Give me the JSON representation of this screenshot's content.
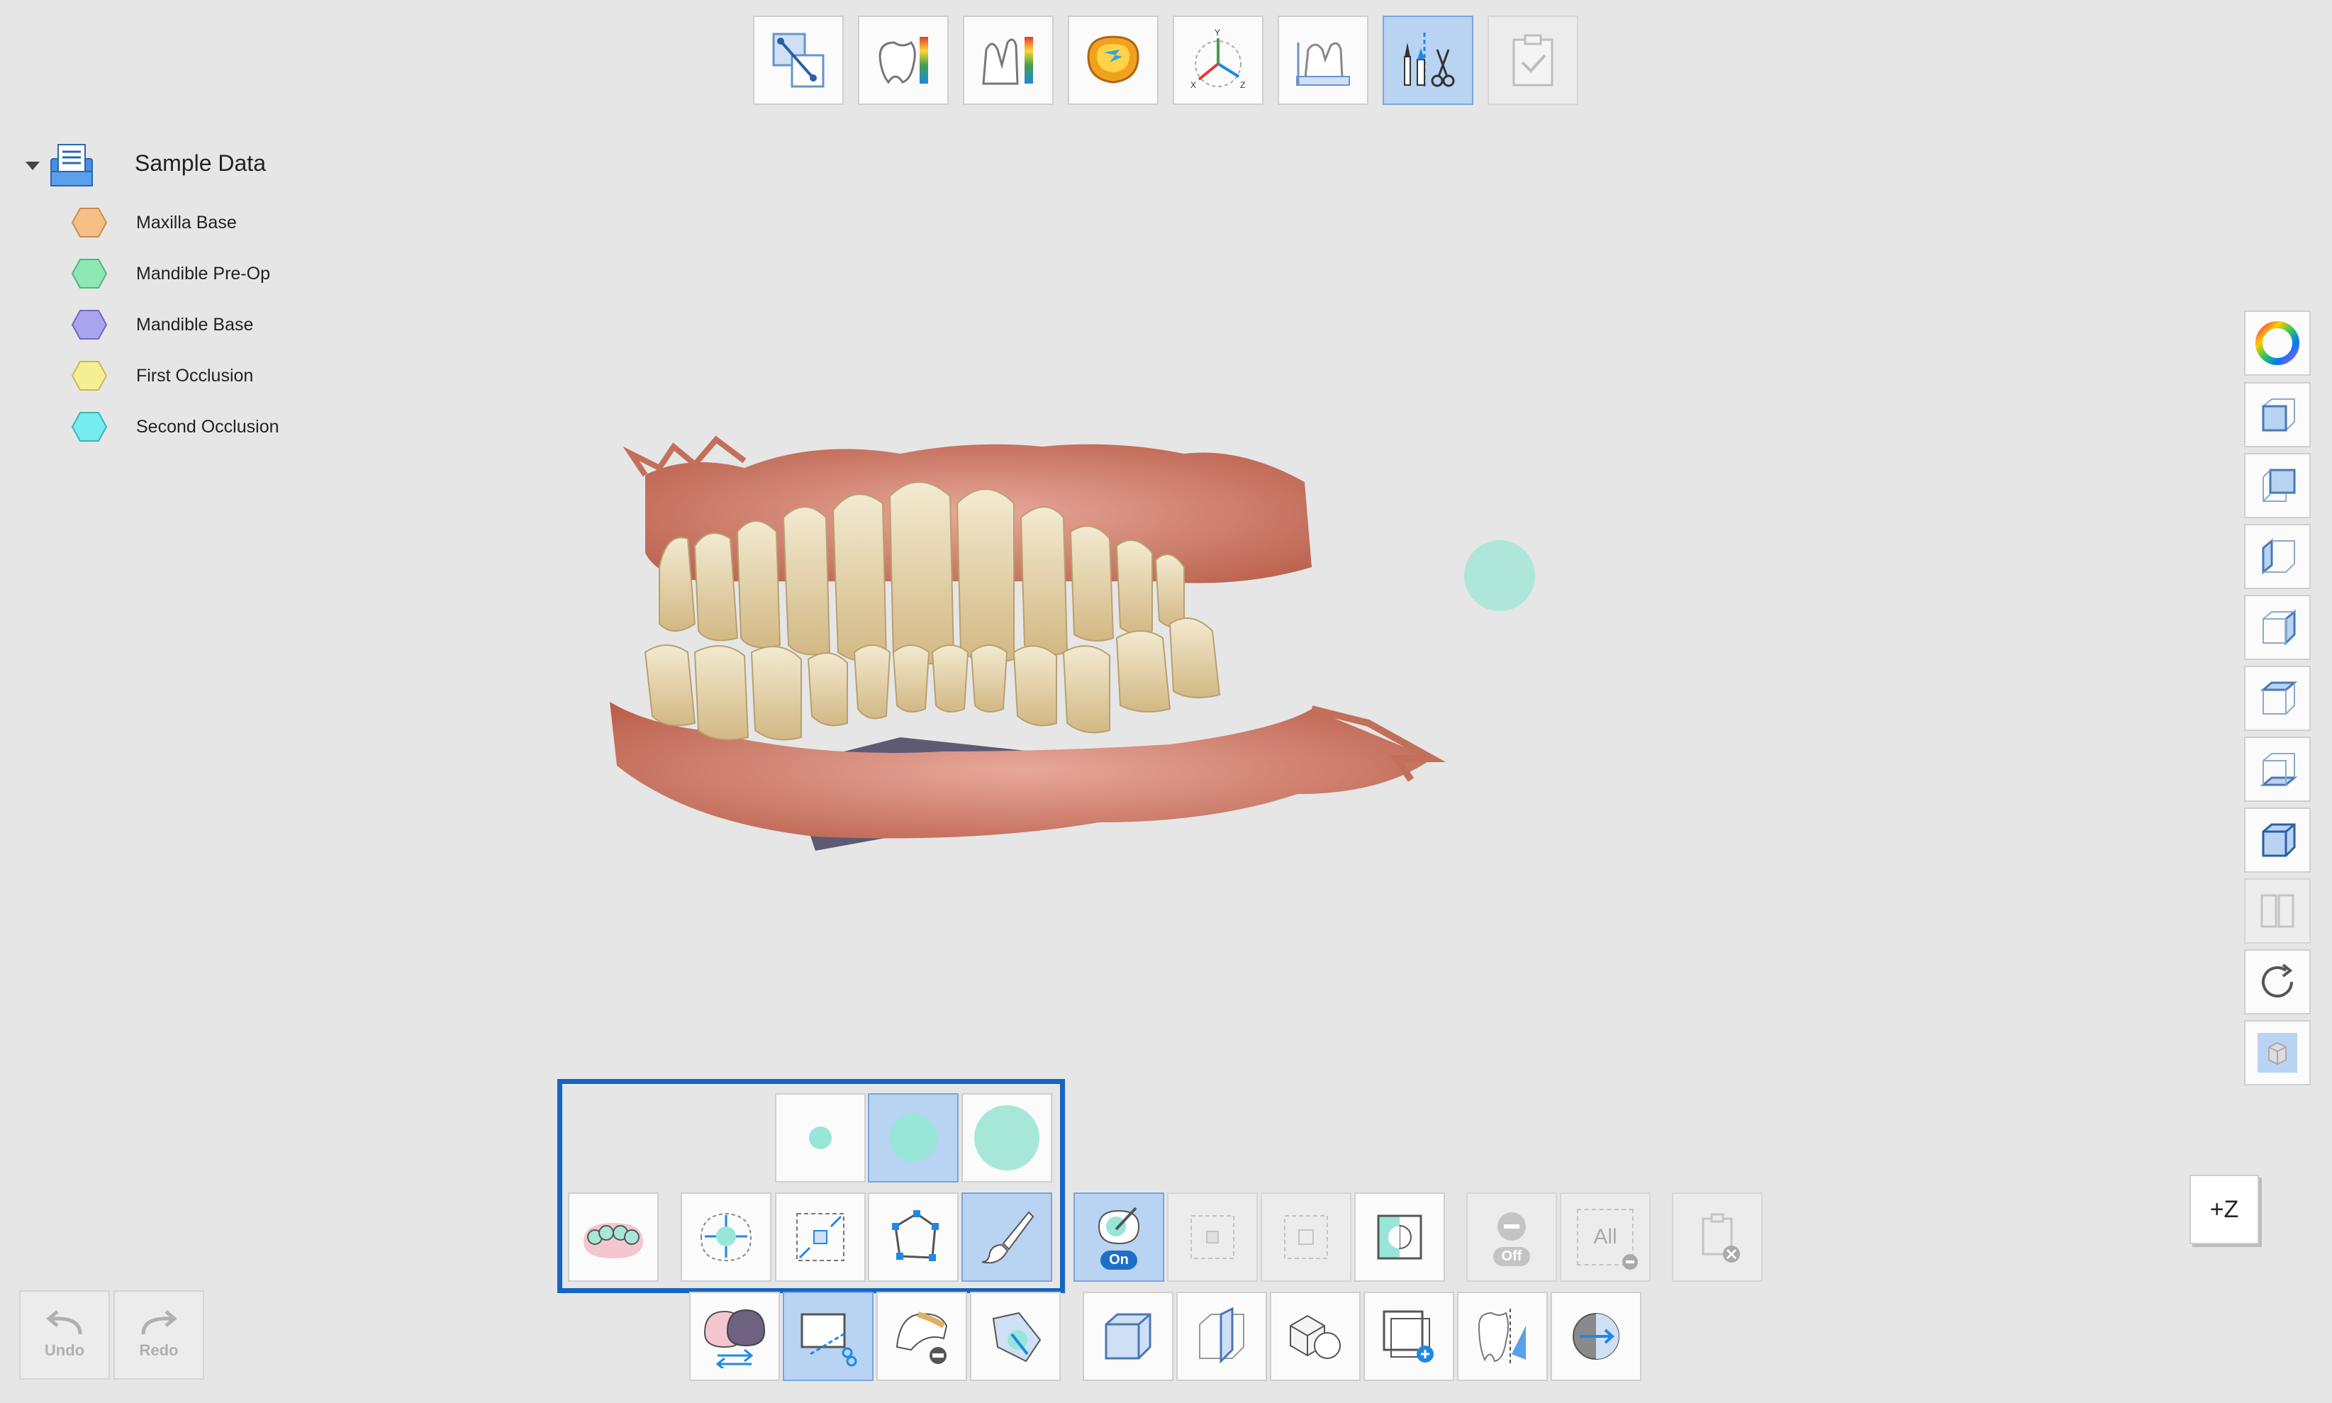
{
  "tree": {
    "root_label": "Sample Data",
    "items": [
      {
        "label": "Maxilla Base",
        "color": "#f6bf86"
      },
      {
        "label": "Mandible Pre-Op",
        "color": "#8ee8b4"
      },
      {
        "label": "Mandible Base",
        "color": "#a9a4ee"
      },
      {
        "label": "First Occlusion",
        "color": "#f5ef94"
      },
      {
        "label": "Second Occlusion",
        "color": "#74ecf0"
      }
    ]
  },
  "top_toolbar": {
    "items": [
      "align-tool",
      "deviation-map",
      "cross-section-deviation",
      "occlusion-analysis",
      "axis-coordinate",
      "measure",
      "trim-tool",
      "finish"
    ],
    "active": "trim-tool"
  },
  "bottom": {
    "toggle_on_label": "On",
    "toggle_off_label": "Off",
    "all_label": "All",
    "undo_label": "Undo",
    "redo_label": "Redo"
  },
  "view_axis_label": "+Z",
  "colors": {
    "accent": "#1565c0",
    "active_bg": "#b9d3f2",
    "brush": "#97e6d7"
  }
}
